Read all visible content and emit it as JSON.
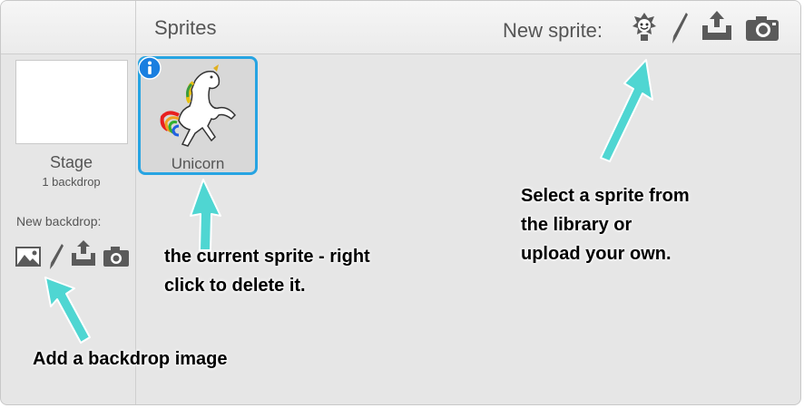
{
  "sprites_panel": {
    "title": "Sprites",
    "new_sprite_label": "New sprite:",
    "new_sprite_icons": [
      "sprite-library-icon",
      "paint-brush-icon",
      "upload-icon",
      "camera-icon"
    ]
  },
  "stage": {
    "label": "Stage",
    "backdrop_count": "1 backdrop",
    "new_backdrop_label": "New backdrop:",
    "new_backdrop_icons": [
      "image-icon",
      "paint-brush-icon",
      "upload-icon",
      "camera-icon"
    ]
  },
  "sprite_list": [
    {
      "name": "Unicorn",
      "selected": true
    }
  ],
  "annotations": {
    "current_sprite_line1": "the current sprite - right",
    "current_sprite_line2": "click to delete it.",
    "library_line1": "Select a sprite from",
    "library_line2": "the library or",
    "library_line3": "upload your own.",
    "backdrop": "Add a backdrop image"
  },
  "colors": {
    "panel_bg": "#e6e6e6",
    "selection_border": "#27a4e2",
    "arrow": "#4fd6d2",
    "info_badge": "#1a7fe0"
  }
}
